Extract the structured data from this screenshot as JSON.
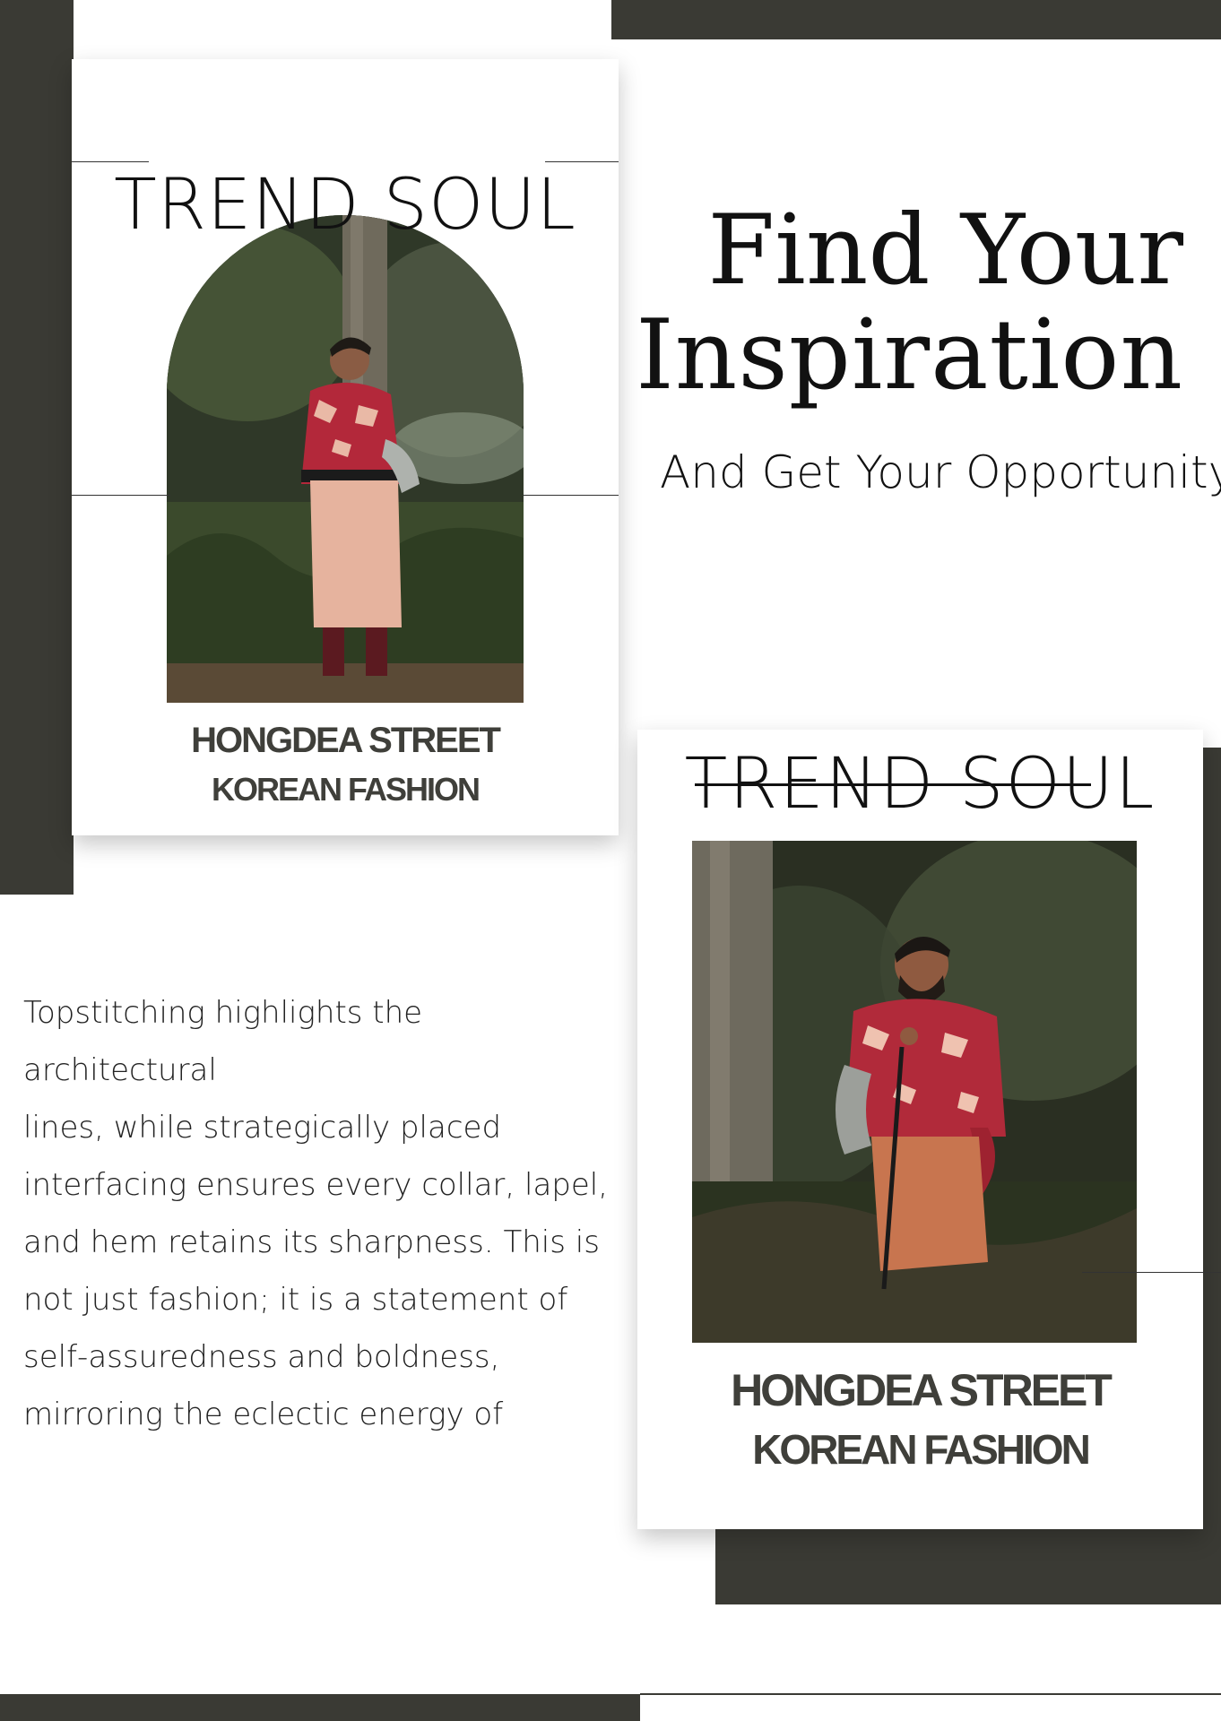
{
  "poster": {
    "colors": {
      "dark_block": "#3a3a34",
      "text_dark": "#111111",
      "subtitle_gray": "#3f3f3a",
      "background": "#ffffff"
    }
  },
  "card_left": {
    "brand": "TREND SOUL",
    "photo": "person-in-red-patterned-robe-standing-in-forest",
    "subtitle_line1": "HONGDEA STREET",
    "subtitle_line2": "KOREAN FASHION"
  },
  "headline": {
    "line1": "Find Your",
    "line2": "Inspiration",
    "tagline": "And Get Your Opportunity"
  },
  "body": {
    "paragraph_lines": [
      "Topstitching highlights the architectural",
      "lines, while strategically placed",
      "interfacing ensures every collar, lapel,",
      "and hem retains its sharpness. This is",
      "not just fashion; it is a statement of",
      "self-assuredness and boldness,",
      "mirroring the eclectic energy of"
    ]
  },
  "card_right": {
    "brand": "TREND SOUL",
    "photo": "person-in-red-patterned-robe-kneeling-in-forest",
    "subtitle_line1": "HONGDEA STREET",
    "subtitle_line2": "KOREAN FASHION"
  }
}
